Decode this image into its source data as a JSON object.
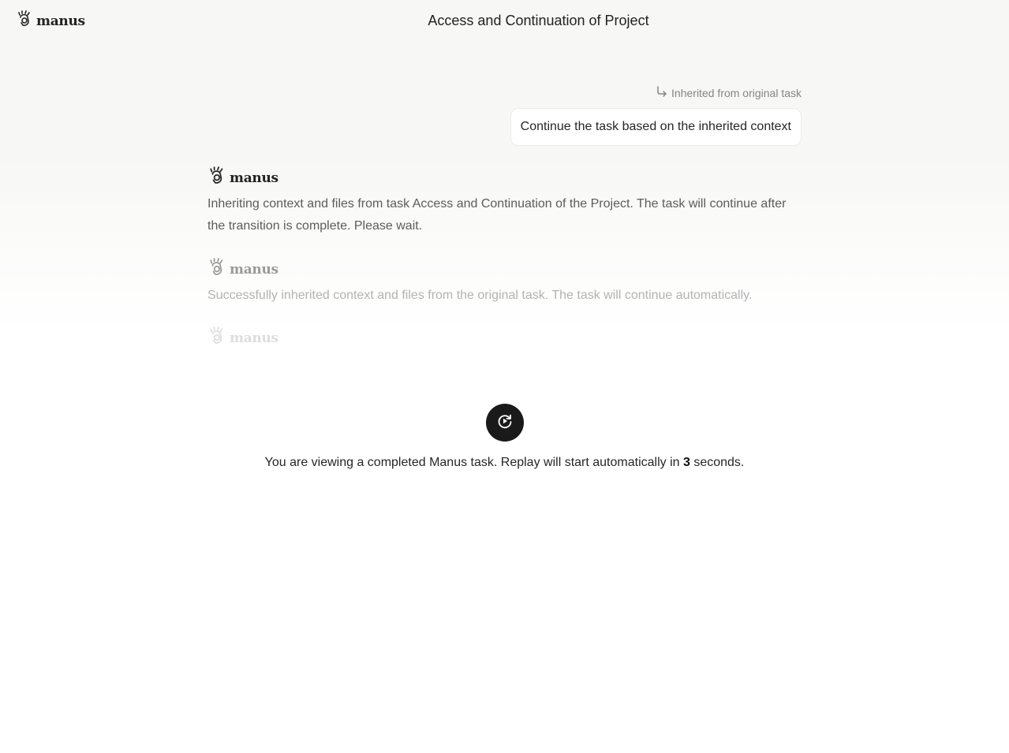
{
  "header": {
    "brand": "manus",
    "title": "Access and Continuation of Project"
  },
  "conversation": {
    "inherited_note": "Inherited from original task",
    "user_message": "Continue the task based on the inherited context",
    "agent_name": "manus",
    "messages": [
      "Inheriting context and files from task Access and Continuation of the Project. The task will continue after the transition is complete. Please wait.",
      "Successfully inherited context and files from the original task. The task will continue automatically."
    ]
  },
  "replay": {
    "text_before": "You are viewing a completed Manus task. Replay will start automatically in ",
    "countdown": "3",
    "text_after": " seconds."
  },
  "colors": {
    "replay_button_bg": "#1a1a1a",
    "text_primary": "#262626",
    "text_muted": "#858585"
  }
}
